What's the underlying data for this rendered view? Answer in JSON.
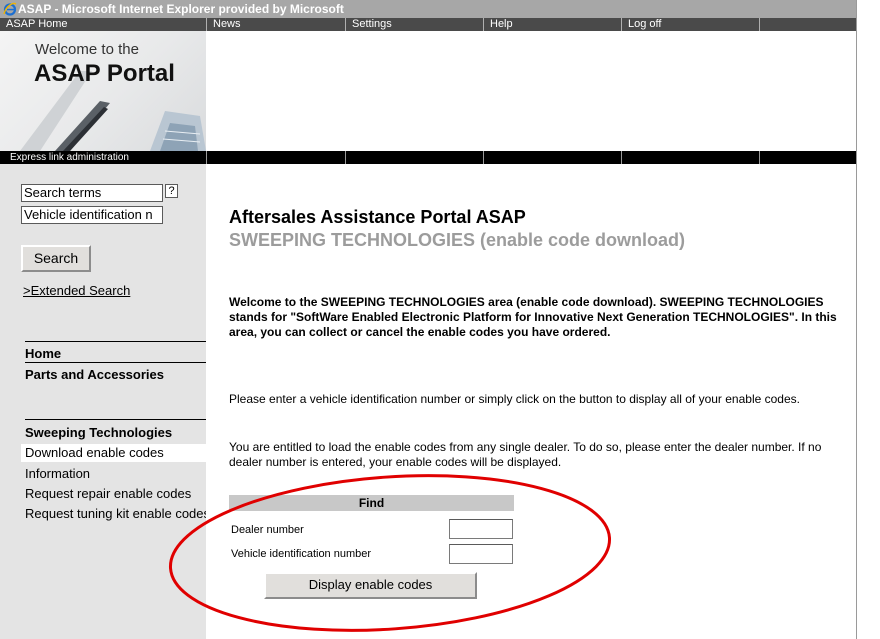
{
  "window": {
    "title": "ASAP - Microsoft Internet Explorer provided by Microsoft"
  },
  "topnav": {
    "items": [
      {
        "label": "ASAP Home"
      },
      {
        "label": "News"
      },
      {
        "label": "Settings"
      },
      {
        "label": "Help"
      },
      {
        "label": "Log off"
      },
      {
        "label": ""
      }
    ]
  },
  "logo": {
    "line1": "Welcome to the",
    "line2": "ASAP Portal"
  },
  "strip": {
    "label": "Express link administration"
  },
  "sidebar": {
    "search_terms_value": "Search terms",
    "help_label": "?",
    "vin_value": "Vehicle identification n",
    "search_label": "Search",
    "extended_search_label": ">Extended Search",
    "home_label": "Home",
    "parts_label": "Parts and Accessories",
    "sweeping_label": "Sweeping Technologies",
    "download_label": "Download enable codes",
    "information_label": "Information",
    "repair_label": "Request repair enable codes",
    "tuning_label": "Request tuning kit enable codes"
  },
  "main": {
    "heading": "Aftersales Assistance Portal ASAP",
    "subheading": "SWEEPING TECHNOLOGIES (enable code download)",
    "intro": "Welcome to the SWEEPING TECHNOLOGIES area (enable code download). SWEEPING TECHNOLOGIES stands for \"SoftWare Enabled Electronic Platform for Innovative Next Generation TECHNOLOGIES\". In this area, you can collect or cancel the enable codes you have ordered.",
    "instruction": "Please enter a vehicle identification number or simply click on the button to display all of your enable codes.",
    "dealer_info": "You are entitled to load the enable codes from any single dealer. To do so, please enter the dealer number. If no dealer number is entered, your enable codes will be displayed."
  },
  "find": {
    "header": "Find",
    "dealer_label": "Dealer number",
    "dealer_value": "",
    "vin_label": "Vehicle identification number",
    "vin_value": "",
    "button_label": "Display enable codes"
  },
  "colors": {
    "highlight_ellipse": "#e00000",
    "sidebar_bg": "#e4e4e4",
    "subheading": "#9c9c9c"
  }
}
